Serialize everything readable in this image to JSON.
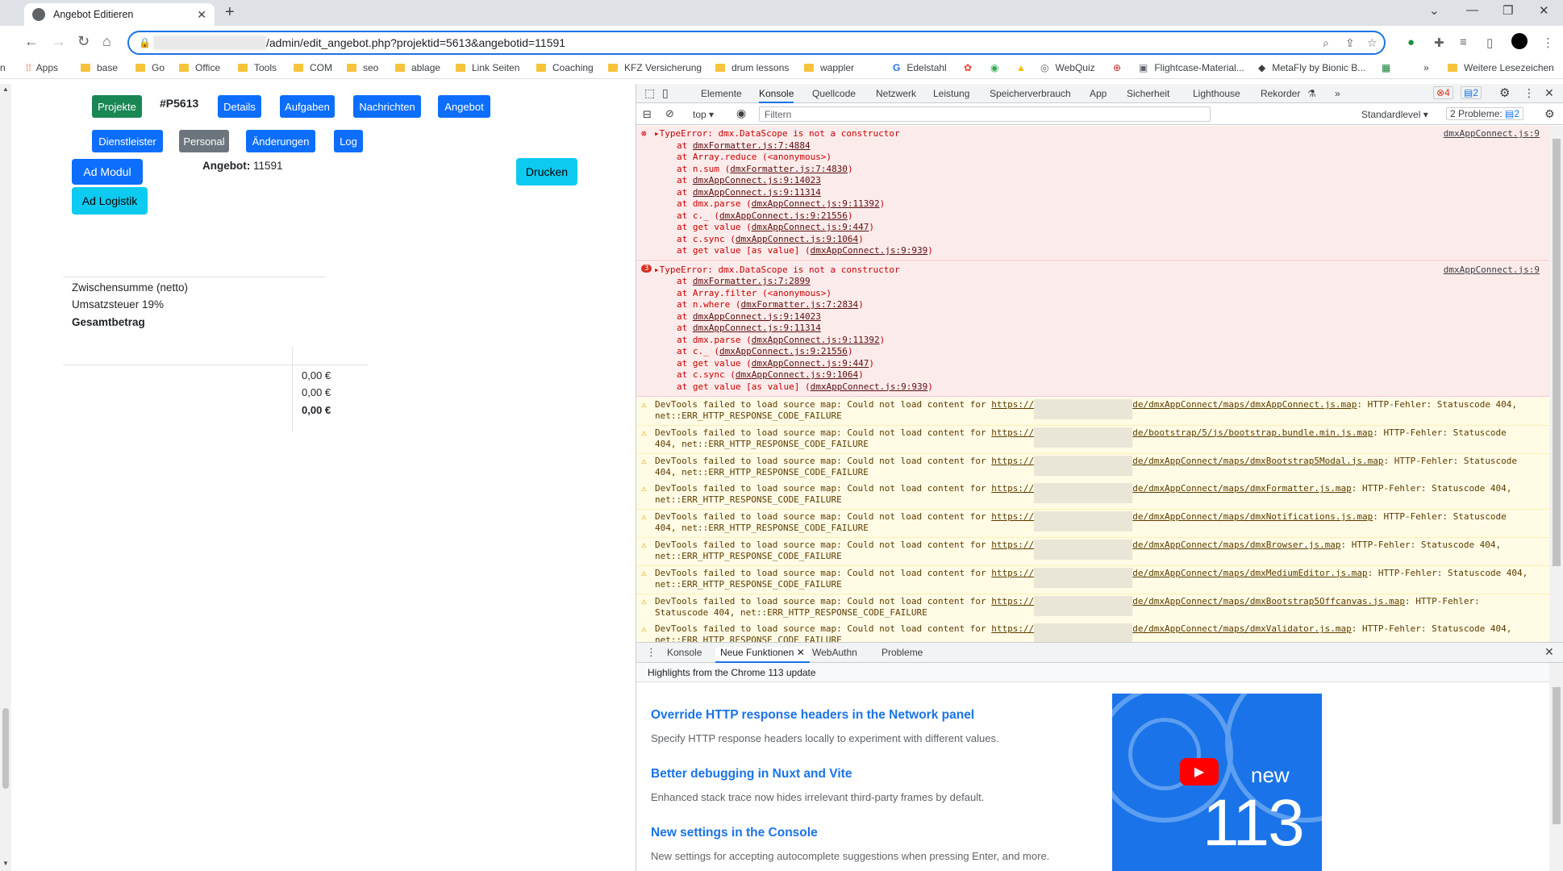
{
  "browser": {
    "tab_title": "Angebot Editieren",
    "url": "/admin/edit_angebot.php?projektid=5613&angebotid=11591",
    "bookmarks": [
      "Apps",
      "base",
      "Go",
      "Office",
      "Tools",
      "COM",
      "seo",
      "ablage",
      "Link Seiten",
      "Coaching",
      "KFZ Versicherung",
      "drum lessons",
      "wappler",
      "Edelstahl",
      "WebQuiz",
      "Flightcase-Material...",
      "MetaFly by Bionic B...",
      "Weitere Lesezeichen"
    ]
  },
  "page": {
    "nav_buttons": {
      "projekte": "Projekte",
      "project_id": "#P5613",
      "details": "Details",
      "aufgaben": "Aufgaben",
      "nachrichten": "Nachrichten",
      "angebot": "Angebot",
      "dienstleister": "Dienstleister",
      "personal": "Personal",
      "aenderungen": "Änderungen",
      "log": "Log",
      "ad_modul": "Ad Modul",
      "ad_logistik": "Ad Logistik",
      "drucken": "Drucken"
    },
    "angebot_label": "Angebot:",
    "angebot_value": "11591",
    "totals": {
      "zwischensumme": "Zwischensumme (netto)",
      "umsatzsteuer": "Umsatzsteuer 19%",
      "gesamtbetrag": "Gesamtbetrag",
      "val1": "0,00 €",
      "val2": "0,00 €",
      "val3": "0,00 €"
    }
  },
  "devtools": {
    "tabs": [
      "Elemente",
      "Konsole",
      "Quellcode",
      "Netzwerk",
      "Leistung",
      "Speicherverbrauch",
      "App",
      "Sicherheit",
      "Lighthouse",
      "Rekorder"
    ],
    "error_count": "4",
    "message_count": "2",
    "context": "top",
    "filter_placeholder": "Filtern",
    "level": "Standardlevel",
    "issues": "2 Probleme:",
    "issues_count": "2",
    "errors": [
      {
        "title": "TypeError: dmx.DataScope is not a constructor",
        "source": "dmxAppConnect.js:9",
        "badge": "",
        "stack": [
          {
            "pre": "at ",
            "link": "dmxFormatter.js:7:4884",
            "post": ""
          },
          {
            "pre": "at Array.reduce (<anonymous>)",
            "link": "",
            "post": ""
          },
          {
            "pre": "at n.sum (",
            "link": "dmxFormatter.js:7:4830",
            "post": ")"
          },
          {
            "pre": "at ",
            "link": "dmxAppConnect.js:9:14023",
            "post": ""
          },
          {
            "pre": "at ",
            "link": "dmxAppConnect.js:9:11314",
            "post": ""
          },
          {
            "pre": "at dmx.parse (",
            "link": "dmxAppConnect.js:9:11392",
            "post": ")"
          },
          {
            "pre": "at c._ (",
            "link": "dmxAppConnect.js:9:21556",
            "post": ")"
          },
          {
            "pre": "at get value (",
            "link": "dmxAppConnect.js:9:447",
            "post": ")"
          },
          {
            "pre": "at c.sync (",
            "link": "dmxAppConnect.js:9:1064",
            "post": ")"
          },
          {
            "pre": "at get value [as value] (",
            "link": "dmxAppConnect.js:9:939",
            "post": ")"
          }
        ]
      },
      {
        "title": "TypeError: dmx.DataScope is not a constructor",
        "source": "dmxAppConnect.js:9",
        "badge": "3",
        "stack": [
          {
            "pre": "at ",
            "link": "dmxFormatter.js:7:2899",
            "post": ""
          },
          {
            "pre": "at Array.filter (<anonymous>)",
            "link": "",
            "post": ""
          },
          {
            "pre": "at n.where (",
            "link": "dmxFormatter.js:7:2834",
            "post": ")"
          },
          {
            "pre": "at ",
            "link": "dmxAppConnect.js:9:14023",
            "post": ""
          },
          {
            "pre": "at ",
            "link": "dmxAppConnect.js:9:11314",
            "post": ""
          },
          {
            "pre": "at dmx.parse (",
            "link": "dmxAppConnect.js:9:11392",
            "post": ")"
          },
          {
            "pre": "at c._ (",
            "link": "dmxAppConnect.js:9:21556",
            "post": ")"
          },
          {
            "pre": "at get value (",
            "link": "dmxAppConnect.js:9:447",
            "post": ")"
          },
          {
            "pre": "at c.sync (",
            "link": "dmxAppConnect.js:9:1064",
            "post": ")"
          },
          {
            "pre": "at get value [as value] (",
            "link": "dmxAppConnect.js:9:939",
            "post": ")"
          }
        ]
      }
    ],
    "warnings": [
      {
        "a": "DevTools failed to load source map: Could not load content for ",
        "link1": "https://",
        "link2": "de/dmxAppConnect/maps/dmxAppConnect.js.map",
        "b": ": HTTP-Fehler: Statuscode 404,",
        "c": "net::ERR_HTTP_RESPONSE_CODE_FAILURE"
      },
      {
        "a": "DevTools failed to load source map: Could not load content for ",
        "link1": "https://",
        "link2": "de/bootstrap/5/js/bootstrap.bundle.min.js.map",
        "b": ": HTTP-Fehler: Statuscode",
        "c": "404, net::ERR_HTTP_RESPONSE_CODE_FAILURE"
      },
      {
        "a": "DevTools failed to load source map: Could not load content for ",
        "link1": "https://",
        "link2": "de/dmxAppConnect/maps/dmxBootstrap5Modal.js.map",
        "b": ": HTTP-Fehler: Statuscode",
        "c": "404, net::ERR_HTTP_RESPONSE_CODE_FAILURE"
      },
      {
        "a": "DevTools failed to load source map: Could not load content for ",
        "link1": "https://",
        "link2": "de/dmxAppConnect/maps/dmxFormatter.js.map",
        "b": ": HTTP-Fehler: Statuscode 404,",
        "c": "net::ERR_HTTP_RESPONSE_CODE_FAILURE"
      },
      {
        "a": "DevTools failed to load source map: Could not load content for ",
        "link1": "https://",
        "link2": "de/dmxAppConnect/maps/dmxNotifications.js.map",
        "b": ": HTTP-Fehler: Statuscode",
        "c": "404, net::ERR_HTTP_RESPONSE_CODE_FAILURE"
      },
      {
        "a": "DevTools failed to load source map: Could not load content for ",
        "link1": "https://",
        "link2": "de/dmxAppConnect/maps/dmxBrowser.js.map",
        "b": ": HTTP-Fehler: Statuscode 404,",
        "c": "net::ERR_HTTP_RESPONSE_CODE_FAILURE"
      },
      {
        "a": "DevTools failed to load source map: Could not load content for ",
        "link1": "https://",
        "link2": "de/dmxAppConnect/maps/dmxMediumEditor.js.map",
        "b": ": HTTP-Fehler: Statuscode 404,",
        "c": "net::ERR_HTTP_RESPONSE_CODE_FAILURE"
      },
      {
        "a": "DevTools failed to load source map: Could not load content for ",
        "link1": "https://",
        "link2": "de/dmxAppConnect/maps/dmxBootstrap5Offcanvas.js.map",
        "b": ": HTTP-Fehler:",
        "c": "Statuscode 404, net::ERR_HTTP_RESPONSE_CODE_FAILURE"
      },
      {
        "a": "DevTools failed to load source map: Could not load content for ",
        "link1": "https://",
        "link2": "de/dmxAppConnect/maps/dmxValidator.js.map",
        "b": ": HTTP-Fehler: Statuscode 404,",
        "c": "net::ERR_HTTP_RESPONSE_CODE_FAILURE"
      }
    ],
    "drawer_tabs": [
      "Konsole",
      "Neue Funktionen",
      "WebAuthn",
      "Probleme"
    ],
    "drawer_header": "Highlights from the Chrome 113 update",
    "features": [
      {
        "title": "Override HTTP response headers in the Network panel",
        "desc": "Specify HTTP response headers locally to experiment with different values."
      },
      {
        "title": "Better debugging in Nuxt and Vite",
        "desc": "Enhanced stack trace now hides irrelevant third-party frames by default."
      },
      {
        "title": "New settings in the Console",
        "desc": "New settings for accepting autocomplete suggestions when pressing Enter, and more."
      }
    ],
    "promo_new": "new",
    "promo_version": "113"
  },
  "colors": {
    "primary": "#0d6efd",
    "success": "#198754",
    "secondary": "#6c757d",
    "info": "#0dcaf0",
    "devtools_link": "#1a73e8"
  }
}
